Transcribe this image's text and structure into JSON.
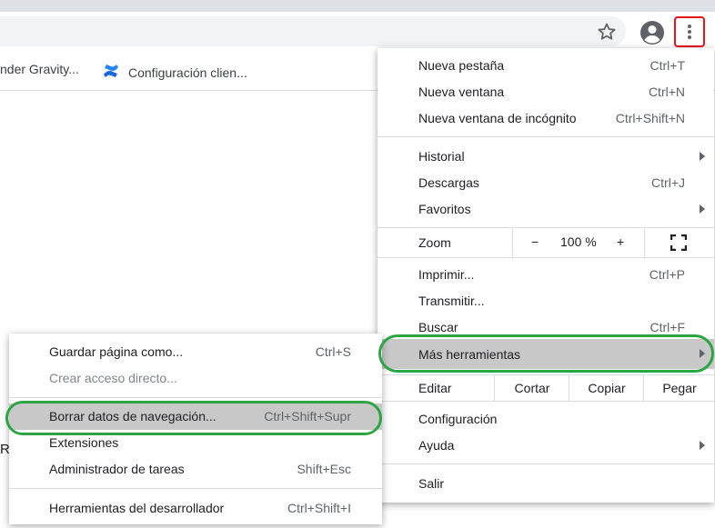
{
  "toolbar": {
    "star_icon": "star-outline-icon",
    "profile_icon": "account-circle-icon",
    "menu_icon": "kebab-menu-icon",
    "highlight_color": "#e8141c"
  },
  "bookmarks": [
    {
      "label": "nder Gravity..."
    },
    {
      "label": "Configuración clien...",
      "icon": "confluence-icon",
      "icon_color": "#1868db"
    }
  ],
  "page": {
    "stray_text": "R"
  },
  "menu": {
    "new_tab": {
      "label": "Nueva pestaña",
      "shortcut": "Ctrl+T"
    },
    "new_window": {
      "label": "Nueva ventana",
      "shortcut": "Ctrl+N"
    },
    "incognito": {
      "label": "Nueva ventana de incógnito",
      "shortcut": "Ctrl+Shift+N"
    },
    "history": {
      "label": "Historial"
    },
    "downloads": {
      "label": "Descargas",
      "shortcut": "Ctrl+J"
    },
    "bookmarks": {
      "label": "Favoritos"
    },
    "zoom": {
      "label": "Zoom",
      "minus": "−",
      "value": "100 %",
      "plus": "+"
    },
    "print": {
      "label": "Imprimir...",
      "shortcut": "Ctrl+P"
    },
    "cast": {
      "label": "Transmitir..."
    },
    "find": {
      "label": "Buscar",
      "shortcut": "Ctrl+F"
    },
    "more_tools": {
      "label": "Más herramientas"
    },
    "edit": {
      "label": "Editar",
      "cut": "Cortar",
      "copy": "Copiar",
      "paste": "Pegar"
    },
    "settings": {
      "label": "Configuración"
    },
    "help": {
      "label": "Ayuda"
    },
    "exit": {
      "label": "Salir"
    }
  },
  "submenu": {
    "save_page": {
      "label": "Guardar página como...",
      "shortcut": "Ctrl+S"
    },
    "create_shortcut": {
      "label": "Crear acceso directo..."
    },
    "clear_data": {
      "label": "Borrar datos de navegación...",
      "shortcut": "Ctrl+Shift+Supr"
    },
    "extensions": {
      "label": "Extensiones"
    },
    "task_manager": {
      "label": "Administrador de tareas",
      "shortcut": "Shift+Esc"
    },
    "devtools": {
      "label": "Herramientas del desarrollador",
      "shortcut": "Ctrl+Shift+I"
    }
  },
  "annotation": {
    "ring_color": "#2ea545"
  }
}
